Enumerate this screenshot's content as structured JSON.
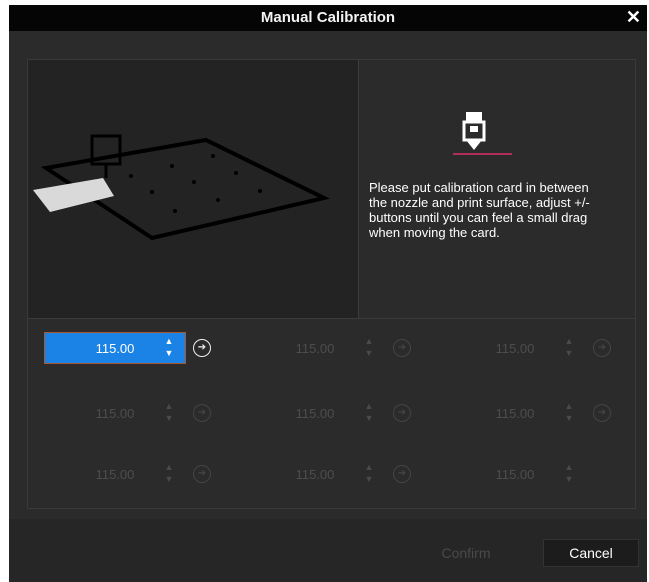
{
  "dialog": {
    "title": "Manual Calibration",
    "close_icon": "close-icon"
  },
  "instructions": "Please put calibration card in between the nozzle and print surface, adjust +/- buttons until you can feel a small drag when moving the card.",
  "points": [
    {
      "value": "115.00",
      "active": true
    },
    {
      "value": "115.00",
      "active": false
    },
    {
      "value": "115.00",
      "active": false
    },
    {
      "value": "115.00",
      "active": false
    },
    {
      "value": "115.00",
      "active": false
    },
    {
      "value": "115.00",
      "active": false
    },
    {
      "value": "115.00",
      "active": false
    },
    {
      "value": "115.00",
      "active": false
    },
    {
      "value": "115.00",
      "active": false
    }
  ],
  "footer": {
    "confirm_label": "Confirm",
    "cancel_label": "Cancel"
  },
  "colors": {
    "accent": "#1a83e5",
    "dialog_bg": "#2b2b2b",
    "titlebar_bg": "#050505",
    "nozzle_line": "#e0306a"
  }
}
